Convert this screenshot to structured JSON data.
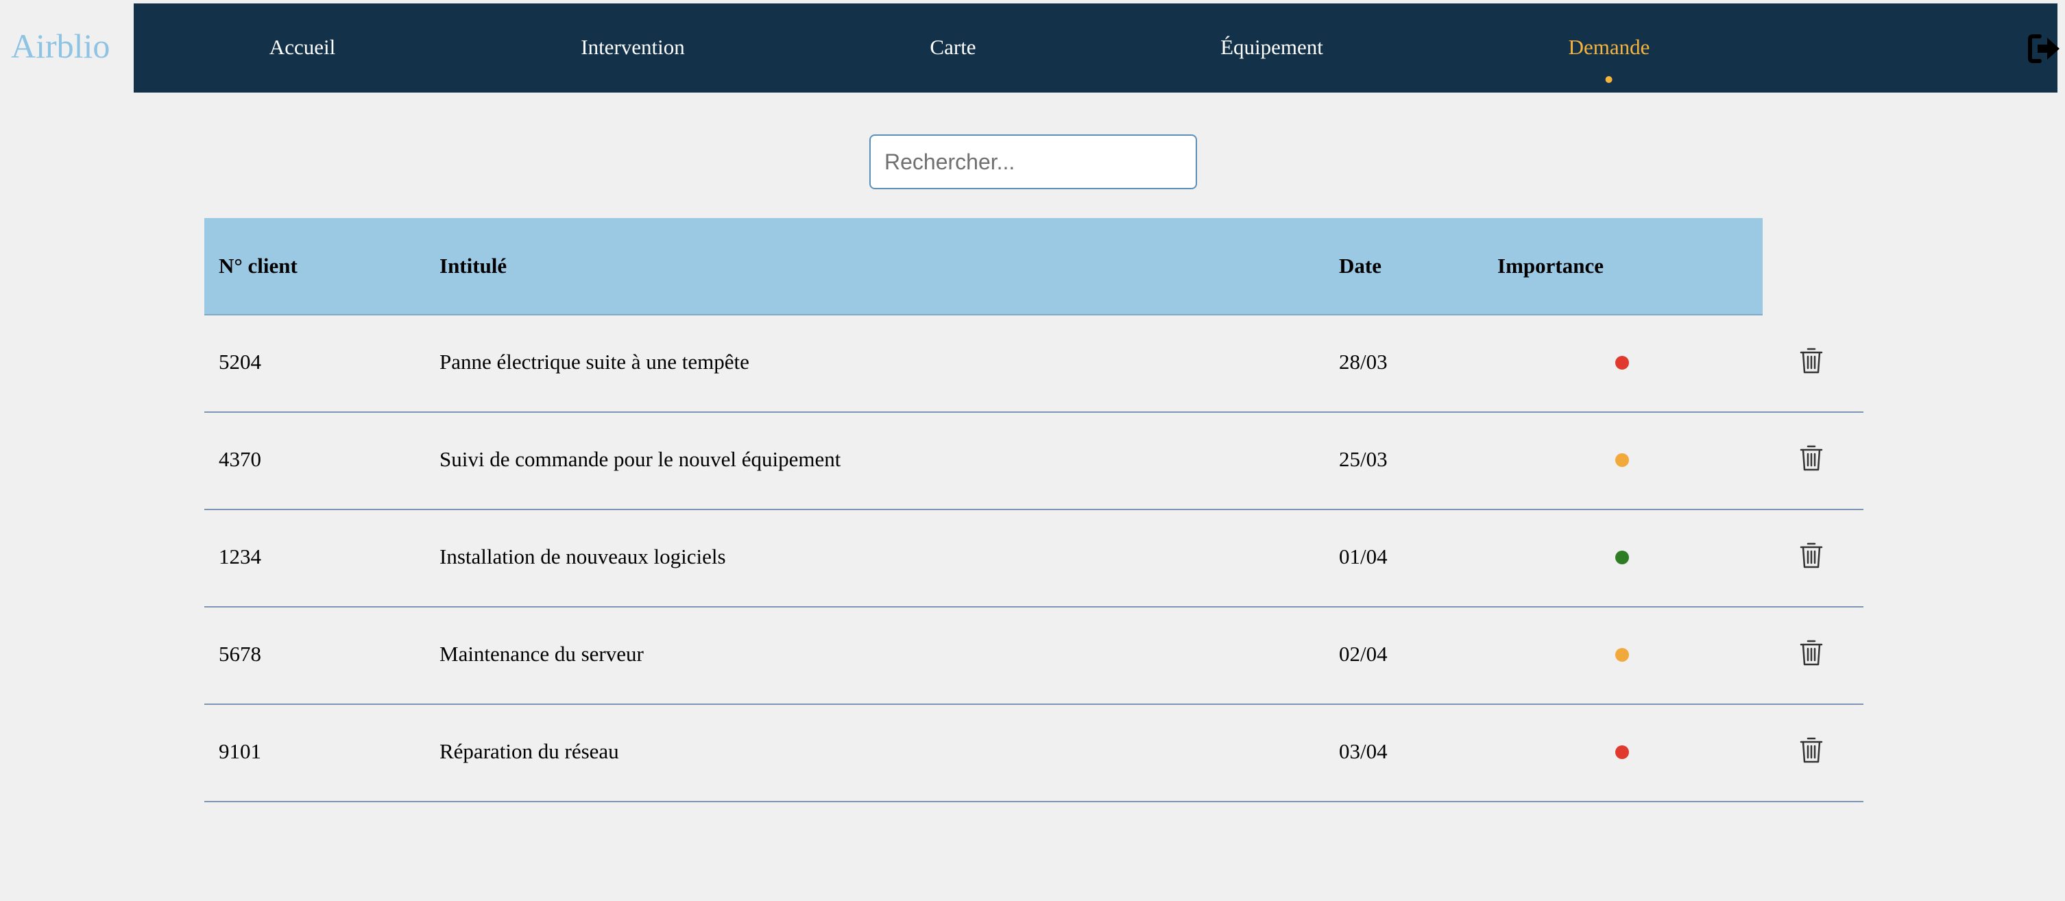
{
  "app": {
    "logo": "Airblio"
  },
  "nav": {
    "items": [
      {
        "label": "Accueil",
        "active": false
      },
      {
        "label": "Intervention",
        "active": false
      },
      {
        "label": "Carte",
        "active": false
      },
      {
        "label": "Équipement",
        "active": false
      },
      {
        "label": "Demande",
        "active": true
      }
    ],
    "logout_icon": "sign-out-icon",
    "background": "#133249",
    "active_color": "#f5b43c"
  },
  "search": {
    "placeholder": "Rechercher...",
    "value": ""
  },
  "table": {
    "headers": {
      "client": "N° client",
      "title": "Intitulé",
      "date": "Date",
      "importance": "Importance"
    },
    "header_background": "#9bc9e4",
    "rows": [
      {
        "client": "5204",
        "title": "Panne électrique suite à une tempête",
        "date": "28/03",
        "importance": "high",
        "importance_color": "#e03a2f",
        "action_icon": "trash-icon"
      },
      {
        "client": "4370",
        "title": "Suivi de commande pour le nouvel équipement",
        "date": "25/03",
        "importance": "medium",
        "importance_color": "#f2a93b",
        "action_icon": "trash-icon"
      },
      {
        "client": "1234",
        "title": "Installation de nouveaux logiciels",
        "date": "01/04",
        "importance": "low",
        "importance_color": "#2e7d24",
        "action_icon": "trash-icon"
      },
      {
        "client": "5678",
        "title": "Maintenance du serveur",
        "date": "02/04",
        "importance": "medium",
        "importance_color": "#f2a93b",
        "action_icon": "trash-icon"
      },
      {
        "client": "9101",
        "title": "Réparation du réseau",
        "date": "03/04",
        "importance": "high",
        "importance_color": "#e03a2f",
        "action_icon": "trash-icon"
      }
    ]
  }
}
